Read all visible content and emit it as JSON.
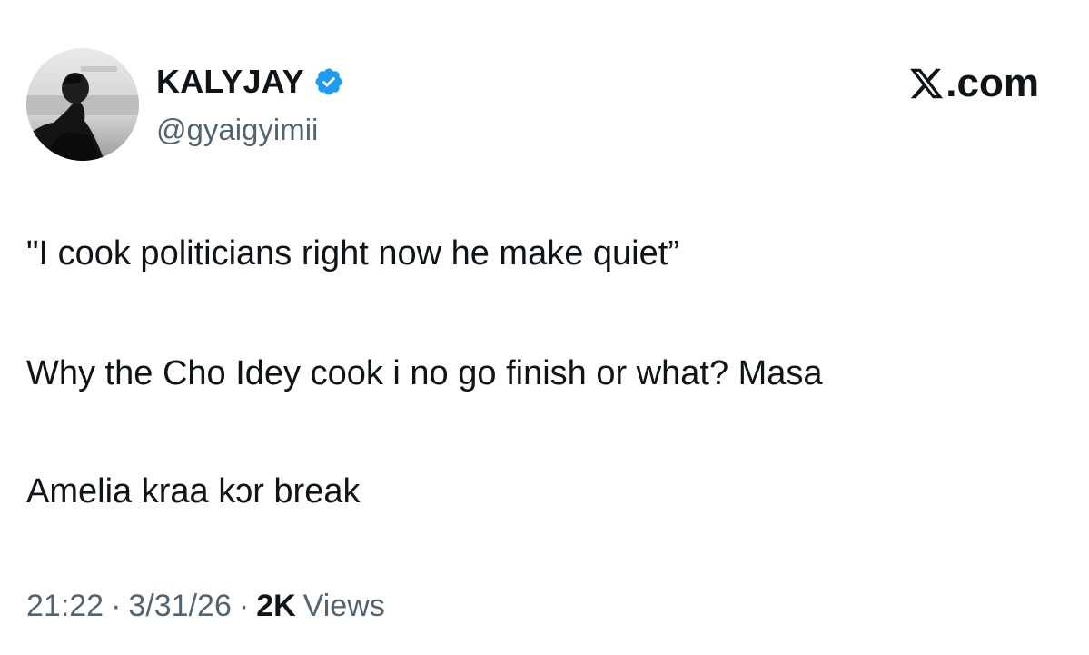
{
  "author": {
    "display_name": "KALYJAY",
    "handle": "@gyaigyimii",
    "verified": true,
    "avatar_icon": "profile-photo"
  },
  "brand": {
    "text": ".com",
    "logo_icon": "x-logo-icon"
  },
  "tweet": {
    "lines": [
      "\"I cook politicians right now he make quiet”",
      "Why the Cho Idey cook i no go finish or what? Masa",
      "Amelia kraa kɔr break"
    ]
  },
  "meta": {
    "time": "21:22",
    "separator": "·",
    "date": "3/31/26",
    "views_count": "2K",
    "views_label": "Views"
  },
  "colors": {
    "text_primary": "#0f1419",
    "text_secondary": "#536471",
    "verified_blue": "#1d9bf0",
    "background": "#ffffff"
  }
}
